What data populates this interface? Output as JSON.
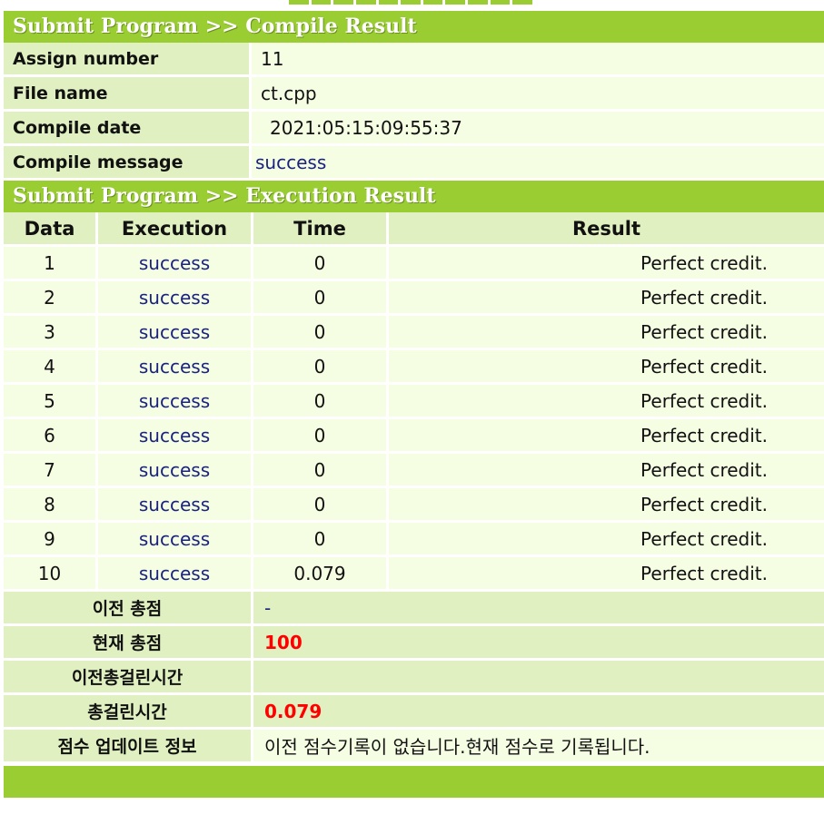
{
  "compile": {
    "header": "Submit Program >> Compile Result",
    "rows": [
      {
        "label": "Assign number",
        "value": "11"
      },
      {
        "label": "File name",
        "value": "ct.cpp"
      },
      {
        "label": "Compile date",
        "value": "2021:05:15:09:55:37"
      },
      {
        "label": "Compile message",
        "value": "success"
      }
    ]
  },
  "execution": {
    "header": "Submit Program >> Execution Result",
    "columns": [
      "Data",
      "Execution",
      "Time",
      "Result"
    ],
    "rows": [
      {
        "data": "1",
        "execution": "success",
        "time": "0",
        "result": "Perfect credit."
      },
      {
        "data": "2",
        "execution": "success",
        "time": "0",
        "result": "Perfect credit."
      },
      {
        "data": "3",
        "execution": "success",
        "time": "0",
        "result": "Perfect credit."
      },
      {
        "data": "4",
        "execution": "success",
        "time": "0",
        "result": "Perfect credit."
      },
      {
        "data": "5",
        "execution": "success",
        "time": "0",
        "result": "Perfect credit."
      },
      {
        "data": "6",
        "execution": "success",
        "time": "0",
        "result": "Perfect credit."
      },
      {
        "data": "7",
        "execution": "success",
        "time": "0",
        "result": "Perfect credit."
      },
      {
        "data": "8",
        "execution": "success",
        "time": "0",
        "result": "Perfect credit."
      },
      {
        "data": "9",
        "execution": "success",
        "time": "0",
        "result": "Perfect credit."
      },
      {
        "data": "10",
        "execution": "success",
        "time": "0.079",
        "result": "Perfect credit."
      }
    ]
  },
  "summary": {
    "rows": [
      {
        "label": "이전 총점",
        "value": "-"
      },
      {
        "label": "현재 총점",
        "value": "100"
      },
      {
        "label": "이전총걸린시간",
        "value": ""
      },
      {
        "label": "총걸린시간",
        "value": "0.079"
      },
      {
        "label": "점수 업데이트 정보",
        "value": "이전 점수기록이 없습니다.현재 점수로 기록됩니다."
      }
    ]
  },
  "colors": {
    "header_green": "#9acd32",
    "label_bg": "#e0f0c0",
    "value_bg": "#f5fde3",
    "link_blue": "#1a237e",
    "score_red": "#ff0000"
  }
}
